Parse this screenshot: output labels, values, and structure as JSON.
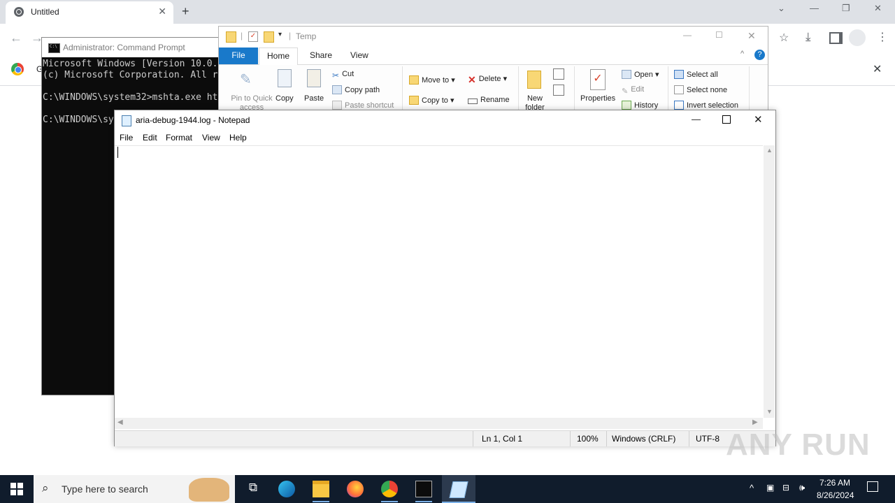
{
  "chrome": {
    "tab_title": "Untitled",
    "new_tab": "+",
    "bookmark_partial": "G"
  },
  "cmd": {
    "title": "Administrator: Command Prompt",
    "lines": [
      "Microsoft Windows [Version 10.0.",
      "(c) Microsoft Corporation. All r",
      "",
      "C:\\WINDOWS\\system32>mshta.exe ht",
      "",
      "C:\\WINDOWS\\sy"
    ]
  },
  "explorer": {
    "title": "Temp",
    "tabs": {
      "file": "File",
      "home": "Home",
      "share": "Share",
      "view": "View"
    },
    "ribbon": {
      "pin": "Pin to Quick access",
      "copy": "Copy",
      "paste": "Paste",
      "cut": "Cut",
      "copy_path": "Copy path",
      "paste_shortcut": "Paste shortcut",
      "move_to": "Move to",
      "copy_to": "Copy to",
      "delete": "Delete",
      "rename": "Rename",
      "new_folder": "New folder",
      "properties": "Properties",
      "open": "Open",
      "edit": "Edit",
      "history": "History",
      "select_all": "Select all",
      "select_none": "Select none",
      "invert_selection": "Invert selection"
    }
  },
  "notepad": {
    "title": "aria-debug-1944.log - Notepad",
    "menu": [
      "File",
      "Edit",
      "Format",
      "View",
      "Help"
    ],
    "content": "",
    "status": {
      "position": "Ln 1, Col 1",
      "zoom": "100%",
      "line_ending": "Windows (CRLF)",
      "encoding": "UTF-8"
    }
  },
  "watermark": "ANY RUN",
  "taskbar": {
    "search_placeholder": "Type here to search",
    "time": "7:26 AM",
    "date": "8/26/2024"
  },
  "colors": {
    "taskbar": "#101c2c",
    "explorer_file_tab": "#1979ca",
    "cmd_bg": "#0c0c0c",
    "chrome_tabstrip": "#dee1e6"
  }
}
